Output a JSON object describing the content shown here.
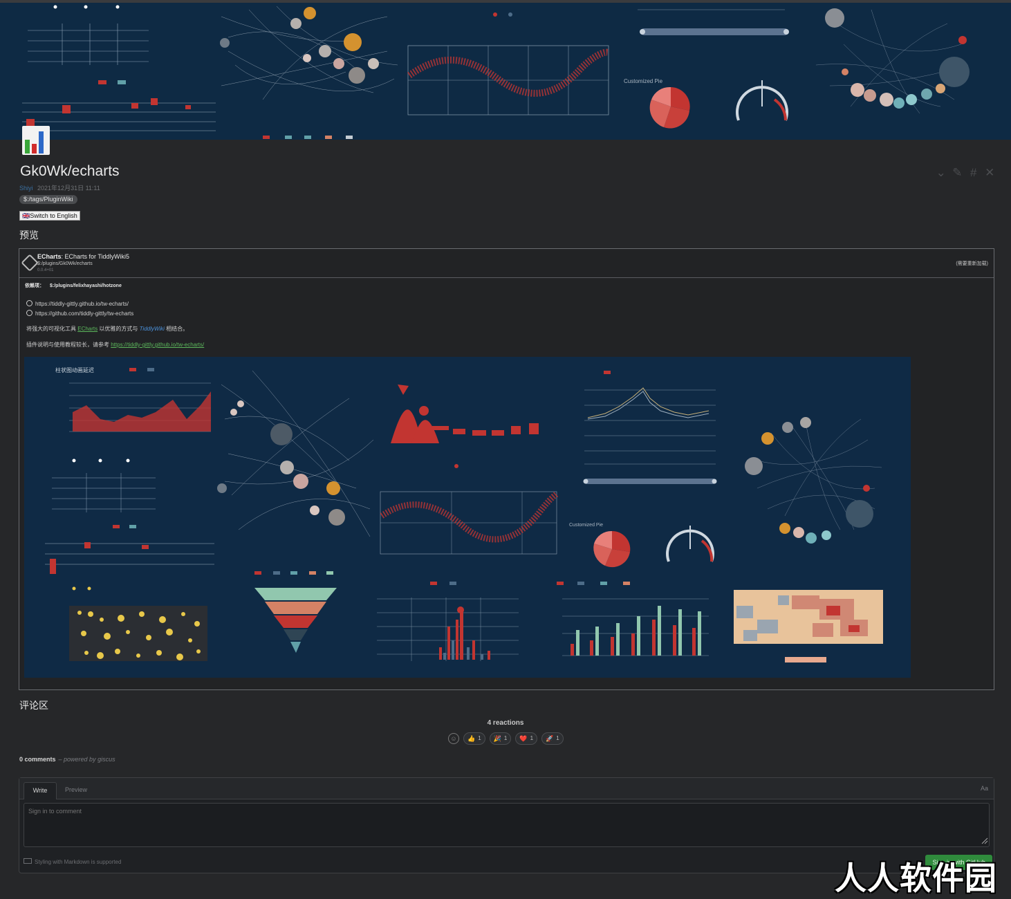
{
  "hero": {
    "description_hidden": ""
  },
  "page": {
    "title": "Gk0Wk/echarts",
    "author": "Shiyi",
    "date": "2021年12月31日 11:11",
    "tag": "$:/tags/PluginWiki",
    "switch_label": "🇬🇧Switch to English",
    "preview_heading": "预览",
    "comments_heading": "评论区"
  },
  "plugin": {
    "name": "ECharts",
    "subtitle": ": ECharts for TiddlyWiki5",
    "path": "$:/plugins/Gk0Wk/echarts",
    "version": "0.0.4+01",
    "reload": "(需要重新加载)",
    "dep_label": "依赖项：",
    "dep_value": "$:/plugins/felixhayashi/hotzone",
    "link1": "https://tiddly-gittly.github.io/tw-echarts/",
    "link2": "https://github.com/tiddly-gittly/tw-echarts",
    "desc_a": "将强大的可视化工具",
    "desc_echarts": "ECharts",
    "desc_b": "以优雅的方式与",
    "desc_tw": "TiddlyWiki",
    "desc_c": "相结合。",
    "usage_a": "插件说明与使用教程较长，请参考",
    "usage_link": "https://tiddly-gittly.github.io/tw-echarts/"
  },
  "demo_labels": {
    "chart1_title": "柱状图动画延迟",
    "pie_title": "Customized Pie",
    "gauge_value": "50%"
  },
  "comments": {
    "reactions_title": "4 reactions",
    "reactions": [
      {
        "emoji": "👍",
        "count": "1"
      },
      {
        "emoji": "🎉",
        "count": "1"
      },
      {
        "emoji": "❤️",
        "count": "1"
      },
      {
        "emoji": "🚀",
        "count": "1"
      }
    ],
    "count_label": "0 comments",
    "powered": "– powered by giscus",
    "tab_write": "Write",
    "tab_preview": "Preview",
    "aa": "Aa",
    "placeholder": "Sign in to comment",
    "markdown_note": "Styling with Markdown is supported",
    "signin_button": "Sign in with GitHub"
  },
  "watermark": "人人软件园",
  "colors": {
    "hero_bg": "#0e2a44",
    "accent_red": "#c23531",
    "accent_orange": "#d48a3a",
    "page_bg": "#262729"
  }
}
